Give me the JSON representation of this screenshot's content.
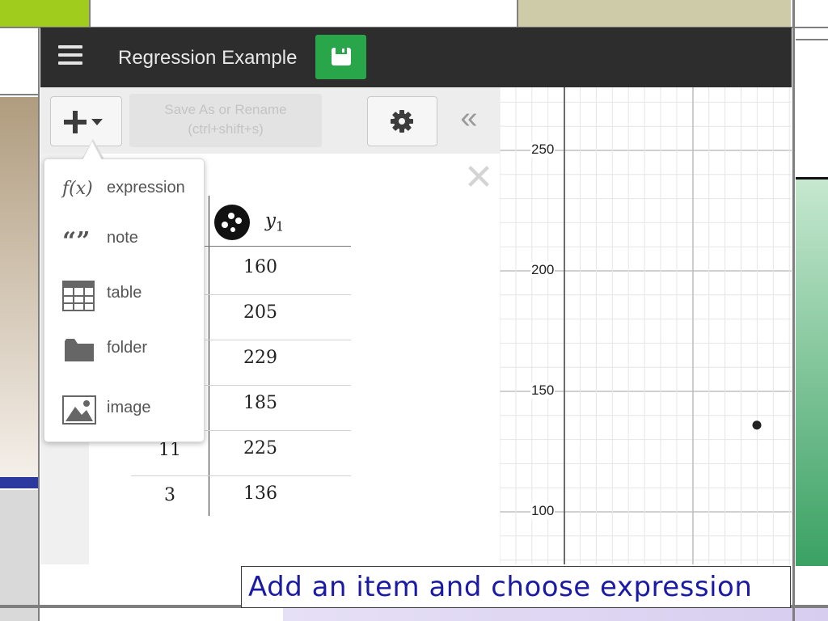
{
  "app": {
    "title": "Regression Example",
    "tooltip_line1": "Save As or Rename",
    "tooltip_line2": "(ctrl+shift+s)"
  },
  "add_menu": {
    "items": [
      {
        "icon": "function-icon",
        "icon_text": "f(x)",
        "label": "expression"
      },
      {
        "icon": "quote-icon",
        "icon_text": "“”",
        "label": "note"
      },
      {
        "icon": "table-icon",
        "label": "table"
      },
      {
        "icon": "folder-icon",
        "label": "folder"
      },
      {
        "icon": "image-icon",
        "label": "image"
      }
    ]
  },
  "table": {
    "y_header": "y",
    "y_header_sub": "1",
    "rows": [
      {
        "x": "",
        "y": "160"
      },
      {
        "x": "",
        "y": "205"
      },
      {
        "x": "",
        "y": "229"
      },
      {
        "x": "",
        "y": "185"
      },
      {
        "x": "11",
        "y": "225"
      },
      {
        "x": "3",
        "y": "136"
      }
    ]
  },
  "graph": {
    "y_ticks": [
      "250",
      "200",
      "150",
      "100"
    ],
    "points": [
      {
        "x": 3,
        "y": 136
      }
    ]
  },
  "caption": "Add an item and choose expression",
  "colors": {
    "topbar": "#2d2d2d",
    "save_button": "#2aa64a",
    "caption_text": "#1a1aa6"
  }
}
